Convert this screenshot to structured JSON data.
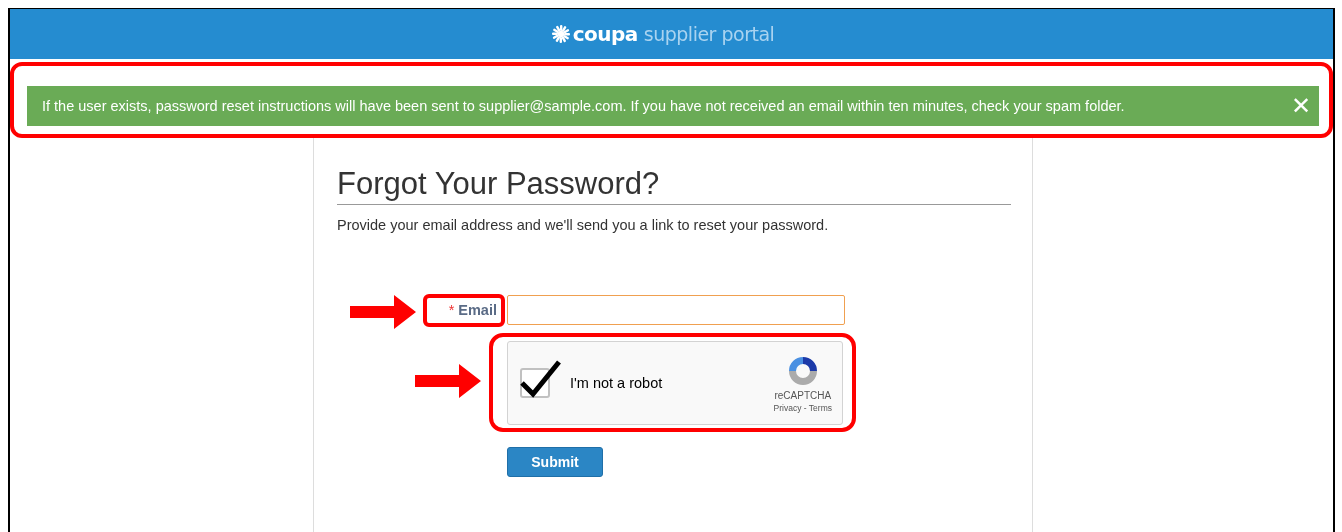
{
  "header": {
    "logo_brand": "coupa",
    "logo_product": "supplier portal"
  },
  "notice": {
    "text": "If the user exists, password reset instructions will have been sent to supplier@sample.com. If you have not received an email within ten minutes, check your spam folder.",
    "close": "✕"
  },
  "form": {
    "title": "Forgot Your Password?",
    "description": "Provide your email address and we'll send you a link to reset your password.",
    "email": {
      "required_mark": "*",
      "label": "Email"
    },
    "captcha": {
      "label": "I'm not a robot",
      "checked": true,
      "brand": "reCAPTCHA",
      "links": "Privacy - Terms"
    },
    "submit": "Submit"
  }
}
